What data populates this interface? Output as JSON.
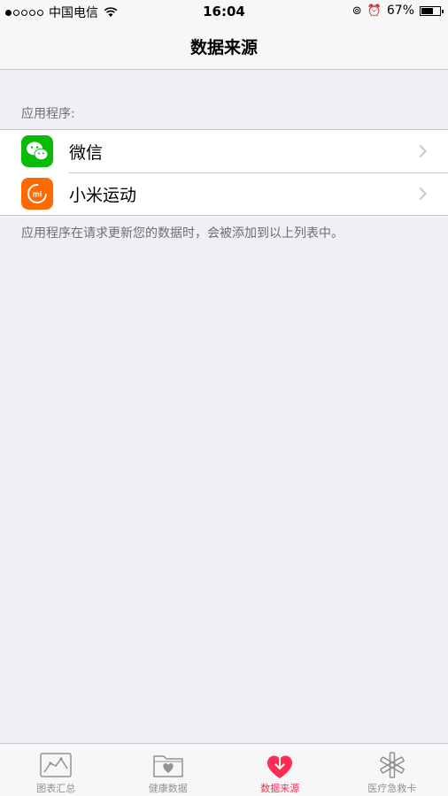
{
  "status_bar": {
    "carrier": "中国电信",
    "time": "16:04",
    "battery_percent": "67%",
    "battery_level": 0.67,
    "signal_bars_filled": 1,
    "signal_bars_total": 5
  },
  "nav": {
    "title": "数据来源"
  },
  "apps_section": {
    "header": "应用程序:",
    "items": [
      {
        "label": "微信",
        "icon": "wechat-icon",
        "color": "#09bb07"
      },
      {
        "label": "小米运动",
        "icon": "mi-fit-icon",
        "color": "#ff6a00"
      }
    ],
    "footer": "应用程序在请求更新您的数据时，会被添加到以上列表中。"
  },
  "tab_bar": {
    "tabs": [
      {
        "label": "图表汇总",
        "icon": "chart-icon",
        "active": false
      },
      {
        "label": "健康数据",
        "icon": "health-folder-icon",
        "active": false
      },
      {
        "label": "数据来源",
        "icon": "sources-heart-icon",
        "active": true
      },
      {
        "label": "医疗急救卡",
        "icon": "medical-id-icon",
        "active": false
      }
    ],
    "active_color": "#ff2d55"
  }
}
